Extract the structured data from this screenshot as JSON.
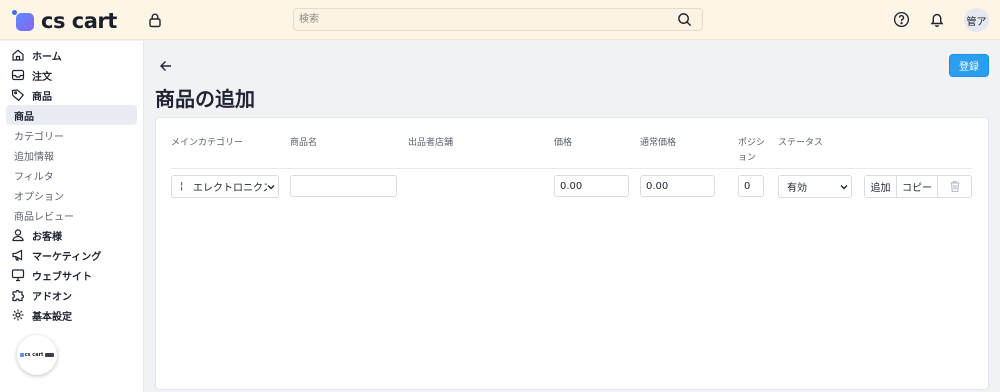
{
  "header": {
    "logo_text": "cs cart",
    "search_placeholder": "検索",
    "avatar_initials": "管ア"
  },
  "sidebar": {
    "items": [
      {
        "label": "ホーム",
        "icon": "home-icon"
      },
      {
        "label": "注文",
        "icon": "inbox-icon"
      },
      {
        "label": "商品",
        "icon": "tag-icon"
      },
      {
        "label": "商品",
        "active": true
      },
      {
        "label": "カテゴリー"
      },
      {
        "label": "追加情報"
      },
      {
        "label": "フィルタ"
      },
      {
        "label": "オプション"
      },
      {
        "label": "商品レビュー"
      },
      {
        "label": "お客様",
        "icon": "user-icon"
      },
      {
        "label": "マーケティング",
        "icon": "megaphone-icon"
      },
      {
        "label": "ウェブサイト",
        "icon": "monitor-icon"
      },
      {
        "label": "アドオン",
        "icon": "puzzle-icon"
      },
      {
        "label": "基本設定",
        "icon": "gear-icon"
      }
    ],
    "mini_logo_text": "cs cart"
  },
  "page": {
    "title": "商品の追加",
    "save_label": "登録"
  },
  "table": {
    "columns": [
      "メインカテゴリー",
      "商品名",
      "出品者店舗",
      "価格",
      "通常価格",
      "ポジション",
      "ステータス"
    ],
    "row": {
      "category_prefix": "¦",
      "category": "エレクトロニクス",
      "product_name": "",
      "price": "0.00",
      "list_price": "0.00",
      "position": "0",
      "status": "有効",
      "add_label": "追加",
      "copy_label": "コピー"
    }
  },
  "colors": {
    "header_bg": "#fdf6e6",
    "primary": "#2b9ef0",
    "page_bg": "#f0f2f6"
  }
}
